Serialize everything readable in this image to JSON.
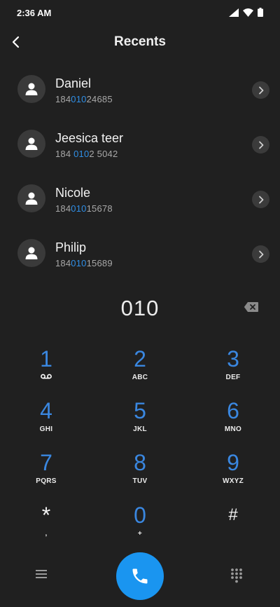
{
  "status_bar": {
    "time": "2:36 AM",
    "icons": [
      "signal-icon",
      "wifi-icon",
      "battery-icon"
    ]
  },
  "header": {
    "title": "Recents",
    "back_icon": "chevron-left-icon"
  },
  "recents": [
    {
      "name": "Daniel",
      "number_parts": [
        "184",
        "010",
        "24685"
      ]
    },
    {
      "name": "Jeesica teer",
      "number_parts": [
        "184 ",
        "010",
        "2 5042"
      ]
    },
    {
      "name": "Nicole",
      "number_parts": [
        "184",
        "010",
        "15678"
      ]
    },
    {
      "name": "Philip",
      "number_parts": [
        "184",
        "010",
        "15689"
      ]
    }
  ],
  "dial": {
    "value": "010",
    "backspace_icon": "backspace-icon"
  },
  "keypad": [
    {
      "digit": "1",
      "letters": "",
      "icon": "voicemail-icon"
    },
    {
      "digit": "2",
      "letters": "ABC"
    },
    {
      "digit": "3",
      "letters": "DEF"
    },
    {
      "digit": "4",
      "letters": "GHI"
    },
    {
      "digit": "5",
      "letters": "JKL"
    },
    {
      "digit": "6",
      "letters": "MNO"
    },
    {
      "digit": "7",
      "letters": "PQRS"
    },
    {
      "digit": "8",
      "letters": "TUV"
    },
    {
      "digit": "9",
      "letters": "WXYZ"
    },
    {
      "digit": "*",
      "letters": ","
    },
    {
      "digit": "0",
      "letters": "+"
    },
    {
      "digit": "#",
      "letters": ""
    }
  ],
  "colors": {
    "accent": "#2f8ee5",
    "call_button": "#1a95f0",
    "background": "#202020"
  }
}
